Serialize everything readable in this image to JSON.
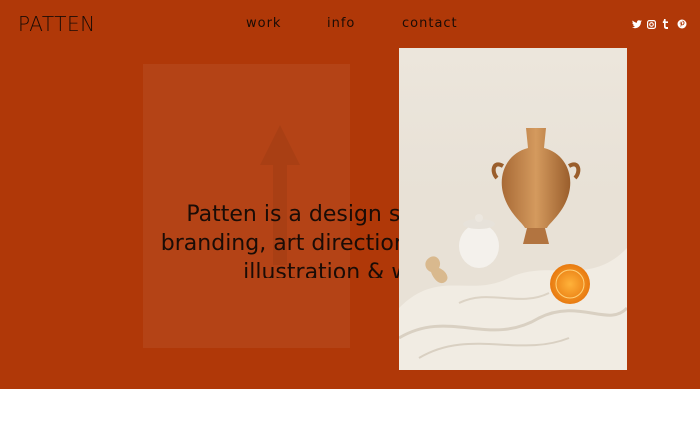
{
  "brand": {
    "logo": "PATTEN"
  },
  "nav": [
    {
      "label": "work"
    },
    {
      "label": "info"
    },
    {
      "label": "contact"
    }
  ],
  "social": [
    "twitter-icon",
    "instagram-icon",
    "tumblr-icon",
    "pinterest-icon"
  ],
  "hero": {
    "headline_line1": "Patten is a design studio for",
    "headline_line2": "branding, art direction, editorial,",
    "headline_line3": "illustration & web",
    "background": "#b03808"
  }
}
